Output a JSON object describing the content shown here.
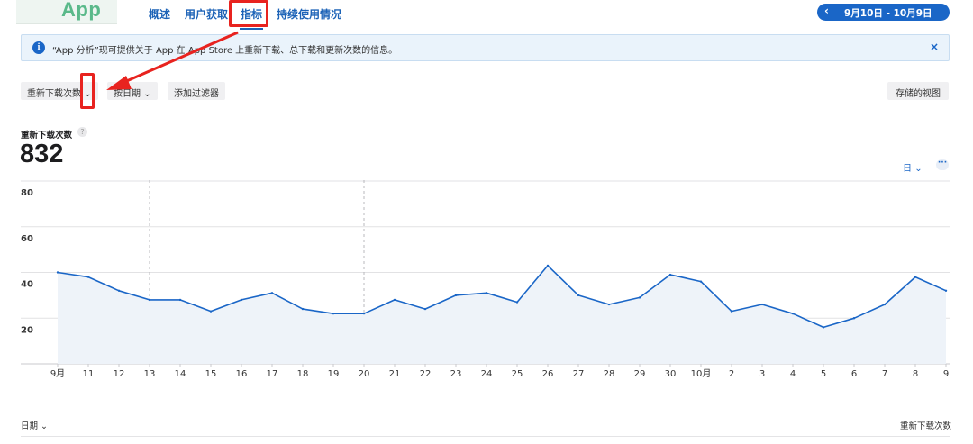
{
  "header": {
    "logo_text": "App",
    "nav": [
      {
        "label": "概述"
      },
      {
        "label": "用户获取"
      },
      {
        "label": "指标"
      },
      {
        "label": "持续使用情况"
      }
    ],
    "date_range": "9月10日 - 10月9日",
    "prev_icon": "chevron-left-icon"
  },
  "banner": {
    "icon": "info-icon",
    "icon_glyph": "i",
    "message": "“App 分析”现可提供关于 App 在 App Store 上重新下载、总下载和更新次数的信息。",
    "close": "×"
  },
  "filters": {
    "metric_select": "重新下载次数",
    "group_by": "按日期",
    "add_filter": "添加过滤器",
    "saved_views": "存储的视图"
  },
  "metric": {
    "label": "重新下载次数",
    "help": "?",
    "value": "832",
    "granularity": "日",
    "more": "···"
  },
  "chart_data": {
    "type": "area",
    "ylim": [
      0,
      80
    ],
    "yticks": [
      20,
      40,
      60,
      80
    ],
    "grid": true,
    "x": [
      "9月",
      "11",
      "12",
      "13",
      "14",
      "15",
      "16",
      "17",
      "18",
      "19",
      "20",
      "21",
      "22",
      "23",
      "24",
      "25",
      "26",
      "27",
      "28",
      "29",
      "30",
      "10月",
      "2",
      "3",
      "4",
      "5",
      "6",
      "7",
      "8",
      "9"
    ],
    "series": [
      {
        "values": [
          40,
          38,
          32,
          28,
          28,
          23,
          28,
          31,
          24,
          22,
          22,
          28,
          24,
          30,
          31,
          27,
          43,
          30,
          26,
          29,
          39,
          36,
          23,
          26,
          22,
          16,
          20,
          26,
          38,
          32
        ]
      }
    ],
    "dashed_markers_at": [
      "13",
      "20"
    ],
    "colors": {
      "line": "#1a66c7",
      "fill": "#eef3f9",
      "grid": "#e2e2e4"
    }
  },
  "table": {
    "date_header": "日期",
    "metric_header": "重新下载次数"
  },
  "annotation_color": "#e8231f"
}
